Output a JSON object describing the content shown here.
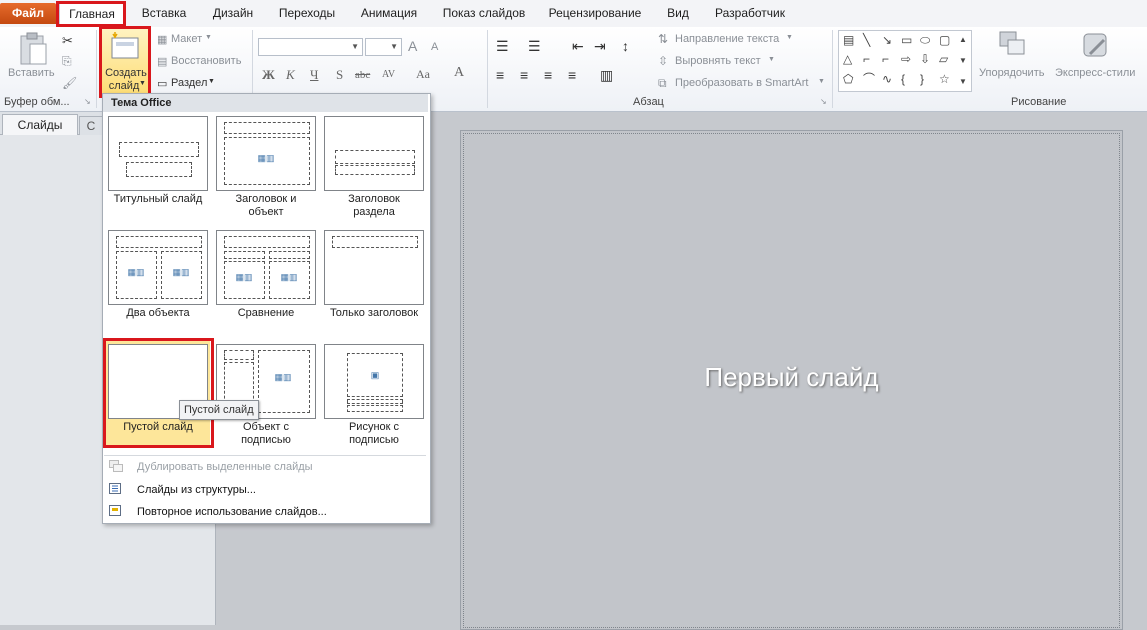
{
  "tabs": {
    "file": "Файл",
    "home": "Главная",
    "insert": "Вставка",
    "design": "Дизайн",
    "transitions": "Переходы",
    "animation": "Анимация",
    "slideshow": "Показ слайдов",
    "review": "Рецензирование",
    "view": "Вид",
    "developer": "Разработчик"
  },
  "ribbon": {
    "paste": "Вставить",
    "clipboard_group": "Буфер обм...",
    "new_slide_line1": "Создать",
    "new_slide_line2": "слайд",
    "layout": "Макет",
    "reset": "Восстановить",
    "section": "Раздел",
    "paragraph_group": "Абзац",
    "text_direction": "Направление текста",
    "align_text": "Выровнять текст",
    "smartart": "Преобразовать в SmartArt",
    "drawing_group": "Рисование",
    "arrange": "Упорядочить",
    "quick_styles": "Экспресс-стили",
    "bold": "Ж",
    "italic": "К",
    "underline": "Ч",
    "strike": "S",
    "abc": "abc",
    "spacing": "AV",
    "case": "Aa",
    "color": "A",
    "grow": "A",
    "shrink": "A"
  },
  "pane": {
    "slides_tab": "Слайды",
    "outline_tab": "С"
  },
  "slide": {
    "title": "Первый слайд"
  },
  "dropdown": {
    "header": "Тема Office",
    "layouts": [
      {
        "line1": "Титульный слайд",
        "line2": ""
      },
      {
        "line1": "Заголовок и",
        "line2": "объект"
      },
      {
        "line1": "Заголовок",
        "line2": "раздела"
      },
      {
        "line1": "Два объекта",
        "line2": ""
      },
      {
        "line1": "Сравнение",
        "line2": ""
      },
      {
        "line1": "Только заголовок",
        "line2": ""
      },
      {
        "line1": "Пустой слайд",
        "line2": ""
      },
      {
        "line1": "Объект с",
        "line2": "подписью"
      },
      {
        "line1": "Рисунок с",
        "line2": "подписью"
      }
    ],
    "tooltip": "Пустой слайд",
    "duplicate": "Дублировать выделенные слайды",
    "from_outline": "Слайды из структуры...",
    "reuse": "Повторное использование слайдов..."
  },
  "colors": {
    "file_tab": "#d85a1e",
    "highlight_red": "#d9171c",
    "selected_layout": "#fde69a"
  }
}
